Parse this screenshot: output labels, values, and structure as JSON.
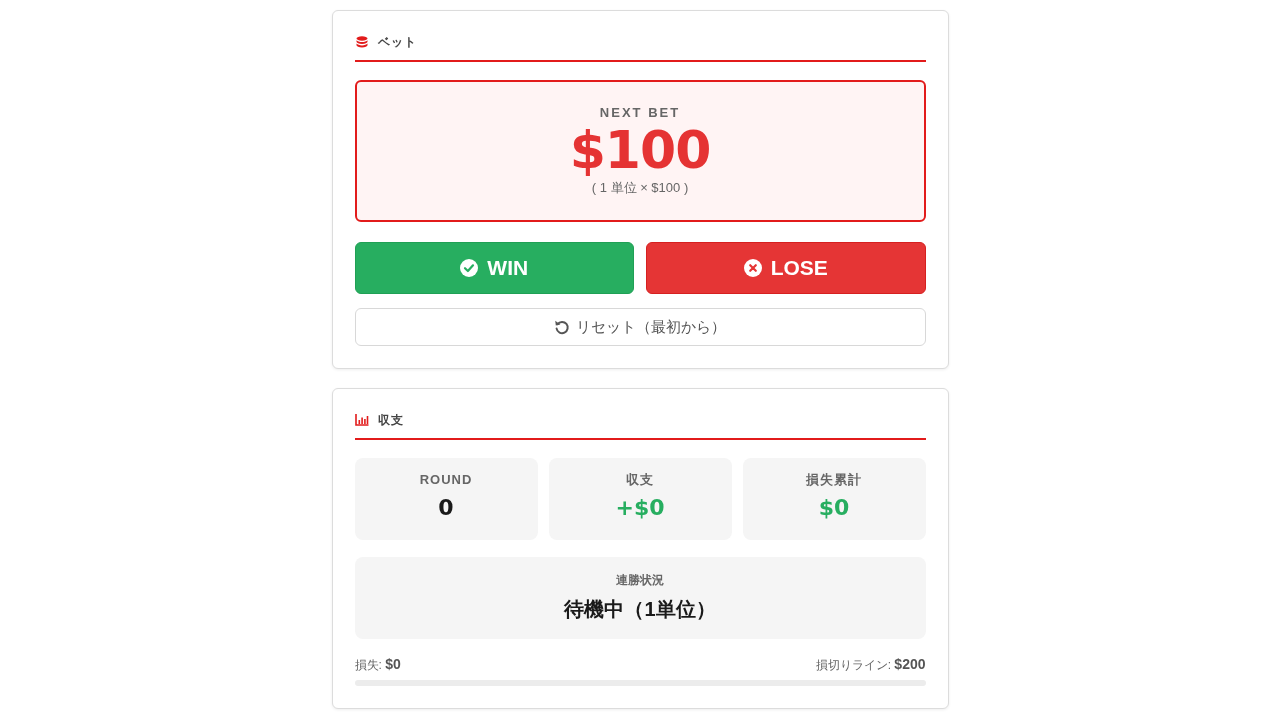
{
  "bet_panel": {
    "title": "ベット",
    "next_bet": {
      "label": "NEXT BET",
      "amount": "$100",
      "detail": "( 1 単位 × $100 )"
    },
    "actions": [
      {
        "kind": "win",
        "label": "WIN"
      },
      {
        "kind": "lose",
        "label": "LOSE"
      }
    ],
    "reset_button": {
      "label": "リセット（最初から）"
    }
  },
  "balance_panel": {
    "title": "収支",
    "stats": [
      {
        "label": "ROUND",
        "value": "0",
        "color": "#1a1a1a"
      },
      {
        "label": "収支",
        "value": "+$0",
        "color": "#27ae60"
      },
      {
        "label": "損失累計",
        "value": "$0",
        "color": "#27ae60"
      }
    ],
    "streak": {
      "label": "連勝状況",
      "value": "待機中（1単位）"
    },
    "loss_meter": {
      "loss": "損失: **$0**",
      "stop_loss": "損切りライン: **$200**",
      "level": 0
    }
  }
}
